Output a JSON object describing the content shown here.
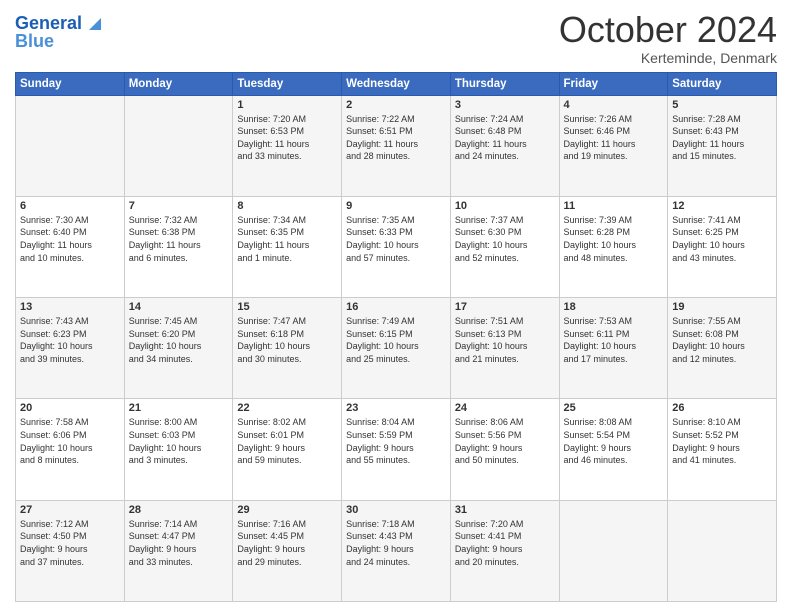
{
  "header": {
    "logo_line1": "General",
    "logo_line2": "Blue",
    "month": "October 2024",
    "location": "Kerteminde, Denmark"
  },
  "weekdays": [
    "Sunday",
    "Monday",
    "Tuesday",
    "Wednesday",
    "Thursday",
    "Friday",
    "Saturday"
  ],
  "weeks": [
    [
      {
        "day": "",
        "info": ""
      },
      {
        "day": "",
        "info": ""
      },
      {
        "day": "1",
        "info": "Sunrise: 7:20 AM\nSunset: 6:53 PM\nDaylight: 11 hours\nand 33 minutes."
      },
      {
        "day": "2",
        "info": "Sunrise: 7:22 AM\nSunset: 6:51 PM\nDaylight: 11 hours\nand 28 minutes."
      },
      {
        "day": "3",
        "info": "Sunrise: 7:24 AM\nSunset: 6:48 PM\nDaylight: 11 hours\nand 24 minutes."
      },
      {
        "day": "4",
        "info": "Sunrise: 7:26 AM\nSunset: 6:46 PM\nDaylight: 11 hours\nand 19 minutes."
      },
      {
        "day": "5",
        "info": "Sunrise: 7:28 AM\nSunset: 6:43 PM\nDaylight: 11 hours\nand 15 minutes."
      }
    ],
    [
      {
        "day": "6",
        "info": "Sunrise: 7:30 AM\nSunset: 6:40 PM\nDaylight: 11 hours\nand 10 minutes."
      },
      {
        "day": "7",
        "info": "Sunrise: 7:32 AM\nSunset: 6:38 PM\nDaylight: 11 hours\nand 6 minutes."
      },
      {
        "day": "8",
        "info": "Sunrise: 7:34 AM\nSunset: 6:35 PM\nDaylight: 11 hours\nand 1 minute."
      },
      {
        "day": "9",
        "info": "Sunrise: 7:35 AM\nSunset: 6:33 PM\nDaylight: 10 hours\nand 57 minutes."
      },
      {
        "day": "10",
        "info": "Sunrise: 7:37 AM\nSunset: 6:30 PM\nDaylight: 10 hours\nand 52 minutes."
      },
      {
        "day": "11",
        "info": "Sunrise: 7:39 AM\nSunset: 6:28 PM\nDaylight: 10 hours\nand 48 minutes."
      },
      {
        "day": "12",
        "info": "Sunrise: 7:41 AM\nSunset: 6:25 PM\nDaylight: 10 hours\nand 43 minutes."
      }
    ],
    [
      {
        "day": "13",
        "info": "Sunrise: 7:43 AM\nSunset: 6:23 PM\nDaylight: 10 hours\nand 39 minutes."
      },
      {
        "day": "14",
        "info": "Sunrise: 7:45 AM\nSunset: 6:20 PM\nDaylight: 10 hours\nand 34 minutes."
      },
      {
        "day": "15",
        "info": "Sunrise: 7:47 AM\nSunset: 6:18 PM\nDaylight: 10 hours\nand 30 minutes."
      },
      {
        "day": "16",
        "info": "Sunrise: 7:49 AM\nSunset: 6:15 PM\nDaylight: 10 hours\nand 25 minutes."
      },
      {
        "day": "17",
        "info": "Sunrise: 7:51 AM\nSunset: 6:13 PM\nDaylight: 10 hours\nand 21 minutes."
      },
      {
        "day": "18",
        "info": "Sunrise: 7:53 AM\nSunset: 6:11 PM\nDaylight: 10 hours\nand 17 minutes."
      },
      {
        "day": "19",
        "info": "Sunrise: 7:55 AM\nSunset: 6:08 PM\nDaylight: 10 hours\nand 12 minutes."
      }
    ],
    [
      {
        "day": "20",
        "info": "Sunrise: 7:58 AM\nSunset: 6:06 PM\nDaylight: 10 hours\nand 8 minutes."
      },
      {
        "day": "21",
        "info": "Sunrise: 8:00 AM\nSunset: 6:03 PM\nDaylight: 10 hours\nand 3 minutes."
      },
      {
        "day": "22",
        "info": "Sunrise: 8:02 AM\nSunset: 6:01 PM\nDaylight: 9 hours\nand 59 minutes."
      },
      {
        "day": "23",
        "info": "Sunrise: 8:04 AM\nSunset: 5:59 PM\nDaylight: 9 hours\nand 55 minutes."
      },
      {
        "day": "24",
        "info": "Sunrise: 8:06 AM\nSunset: 5:56 PM\nDaylight: 9 hours\nand 50 minutes."
      },
      {
        "day": "25",
        "info": "Sunrise: 8:08 AM\nSunset: 5:54 PM\nDaylight: 9 hours\nand 46 minutes."
      },
      {
        "day": "26",
        "info": "Sunrise: 8:10 AM\nSunset: 5:52 PM\nDaylight: 9 hours\nand 41 minutes."
      }
    ],
    [
      {
        "day": "27",
        "info": "Sunrise: 7:12 AM\nSunset: 4:50 PM\nDaylight: 9 hours\nand 37 minutes."
      },
      {
        "day": "28",
        "info": "Sunrise: 7:14 AM\nSunset: 4:47 PM\nDaylight: 9 hours\nand 33 minutes."
      },
      {
        "day": "29",
        "info": "Sunrise: 7:16 AM\nSunset: 4:45 PM\nDaylight: 9 hours\nand 29 minutes."
      },
      {
        "day": "30",
        "info": "Sunrise: 7:18 AM\nSunset: 4:43 PM\nDaylight: 9 hours\nand 24 minutes."
      },
      {
        "day": "31",
        "info": "Sunrise: 7:20 AM\nSunset: 4:41 PM\nDaylight: 9 hours\nand 20 minutes."
      },
      {
        "day": "",
        "info": ""
      },
      {
        "day": "",
        "info": ""
      }
    ]
  ]
}
